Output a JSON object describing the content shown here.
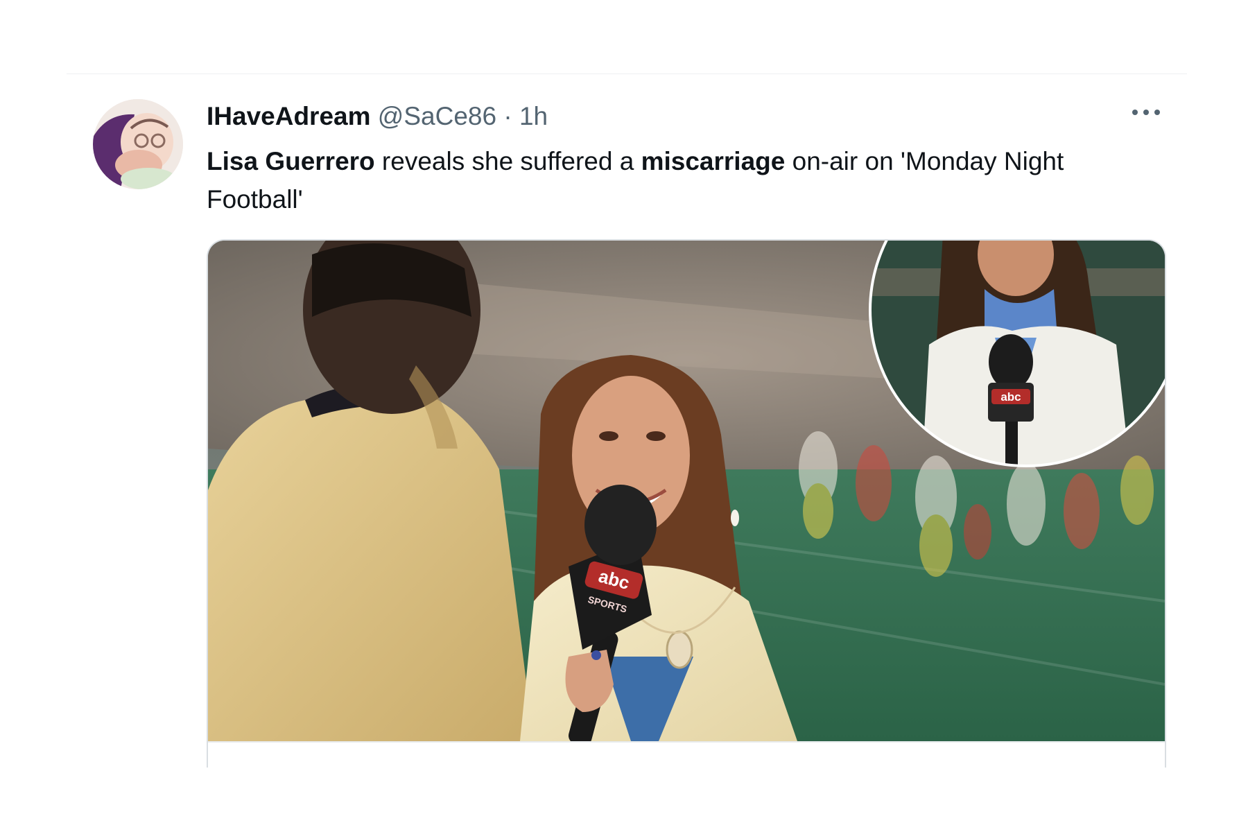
{
  "tweet": {
    "author": {
      "display_name": "IHaveAdream",
      "handle": "@SaCe86"
    },
    "separator": "·",
    "time": "1h",
    "more_icon": "ellipsis-icon",
    "text": {
      "name_bold": "Lisa Guerrero",
      "part1": " reveals she suffered a ",
      "keyword_bold": "miscarriage",
      "part2": " on-air on 'Monday Night Football'"
    },
    "media": {
      "mic_flag_text": "abc",
      "mic_flag_subtext": "SPORTS",
      "inset_mic_flag_text": "abc"
    }
  },
  "colors": {
    "text_primary": "#0f1419",
    "text_secondary": "#536471",
    "border": "#d9dee2",
    "field_green": "#2f6b4d",
    "jacket_gold": "#dcc182"
  }
}
